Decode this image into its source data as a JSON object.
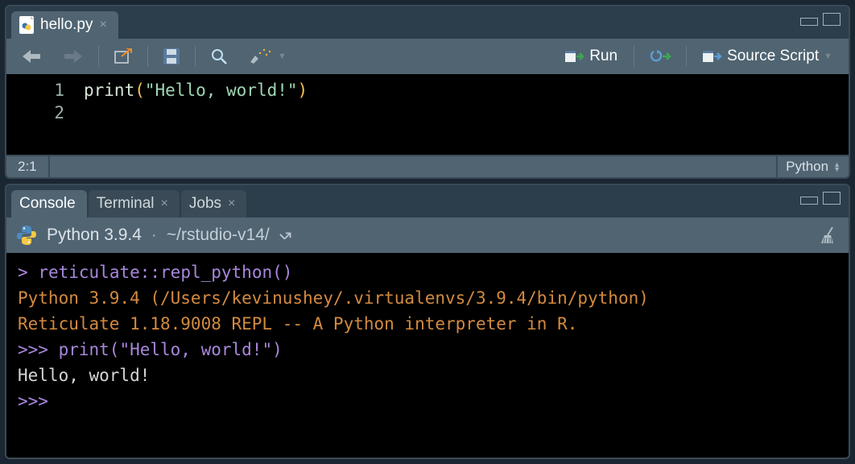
{
  "top_pane": {
    "tab": {
      "filename": "hello.py"
    },
    "toolbar": {
      "run_label": "Run",
      "source_label": "Source Script"
    },
    "editor": {
      "lines": {
        "func": "print",
        "open": "(",
        "str": "\"Hello, world!\"",
        "close": ")"
      }
    },
    "statusbar": {
      "pos": "2:1",
      "lang": "Python"
    }
  },
  "bot_pane": {
    "tabs": {
      "console": "Console",
      "terminal": "Terminal",
      "jobs": "Jobs"
    },
    "header": {
      "version": "Python 3.9.4",
      "path": "~/rstudio-v14/"
    },
    "console": {
      "l1_prompt": ">",
      "l1_cmd": "reticulate::repl_python()",
      "l2": "Python 3.9.4 (/Users/kevinushey/.virtualenvs/3.9.4/bin/python)",
      "l3": "Reticulate 1.18.9008 REPL -- A Python interpreter in R.",
      "l4_prompt": ">>>",
      "l4_cmd": "print(\"Hello, world!\")",
      "l5": "Hello, world!",
      "l6_prompt": ">>>"
    }
  }
}
